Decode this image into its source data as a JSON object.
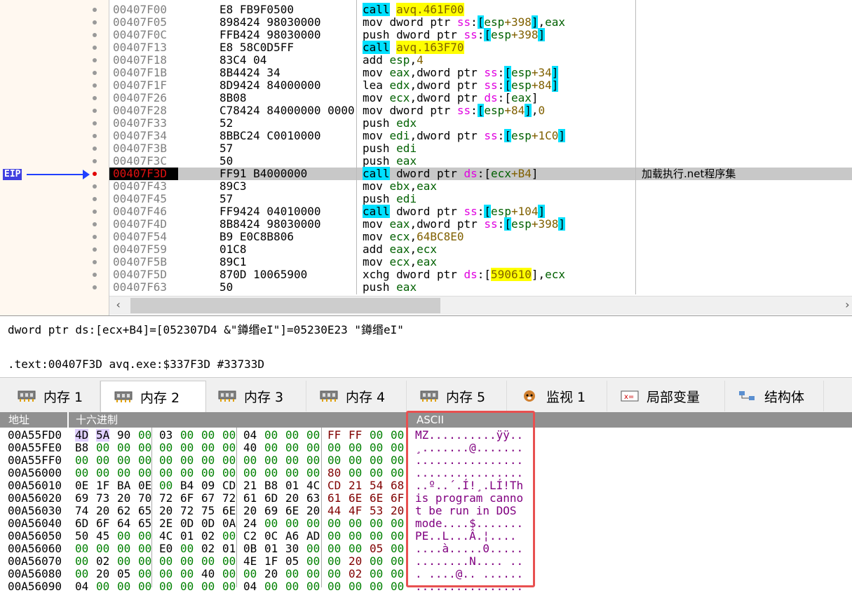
{
  "disasm": {
    "eip_label": "EIP",
    "rows": [
      {
        "addr": "00407F00",
        "bytes": "E8 FB9F0500",
        "instr": [
          {
            "t": "call",
            "c": "kw-call"
          },
          {
            "t": " "
          },
          {
            "t": "avq.461F00",
            "c": "sym"
          }
        ]
      },
      {
        "addr": "00407F05",
        "bytes": "898424 98030000",
        "instr": [
          {
            "t": "mov dword ptr "
          },
          {
            "t": "ss",
            "c": "seg"
          },
          {
            "t": ":"
          },
          {
            "t": "[",
            "c": "brk"
          },
          {
            "t": "esp",
            "c": "reg"
          },
          {
            "t": "+398",
            "c": "num"
          },
          {
            "t": "]",
            "c": "brk"
          },
          {
            "t": ","
          },
          {
            "t": "eax",
            "c": "reg"
          }
        ]
      },
      {
        "addr": "00407F0C",
        "bytes": "FFB424 98030000",
        "instr": [
          {
            "t": "push dword ptr "
          },
          {
            "t": "ss",
            "c": "seg"
          },
          {
            "t": ":"
          },
          {
            "t": "[",
            "c": "brk"
          },
          {
            "t": "esp",
            "c": "reg"
          },
          {
            "t": "+398",
            "c": "num"
          },
          {
            "t": "]",
            "c": "brk"
          }
        ]
      },
      {
        "addr": "00407F13",
        "bytes": "E8 58C0D5FF",
        "instr": [
          {
            "t": "call",
            "c": "kw-call"
          },
          {
            "t": " "
          },
          {
            "t": "avq.163F70",
            "c": "sym"
          }
        ]
      },
      {
        "addr": "00407F18",
        "bytes": "83C4 04",
        "instr": [
          {
            "t": "add "
          },
          {
            "t": "esp",
            "c": "reg"
          },
          {
            "t": ","
          },
          {
            "t": "4",
            "c": "num"
          }
        ]
      },
      {
        "addr": "00407F1B",
        "bytes": "8B4424 34",
        "instr": [
          {
            "t": "mov "
          },
          {
            "t": "eax",
            "c": "reg"
          },
          {
            "t": ",dword ptr "
          },
          {
            "t": "ss",
            "c": "seg"
          },
          {
            "t": ":"
          },
          {
            "t": "[",
            "c": "brk"
          },
          {
            "t": "esp",
            "c": "reg"
          },
          {
            "t": "+34",
            "c": "num"
          },
          {
            "t": "]",
            "c": "brk"
          }
        ]
      },
      {
        "addr": "00407F1F",
        "bytes": "8D9424 84000000",
        "instr": [
          {
            "t": "lea "
          },
          {
            "t": "edx",
            "c": "reg"
          },
          {
            "t": ",dword ptr "
          },
          {
            "t": "ss",
            "c": "seg"
          },
          {
            "t": ":"
          },
          {
            "t": "[",
            "c": "brk"
          },
          {
            "t": "esp",
            "c": "reg"
          },
          {
            "t": "+84",
            "c": "num"
          },
          {
            "t": "]",
            "c": "brk"
          }
        ]
      },
      {
        "addr": "00407F26",
        "bytes": "8B08",
        "instr": [
          {
            "t": "mov "
          },
          {
            "t": "ecx",
            "c": "reg"
          },
          {
            "t": ",dword ptr "
          },
          {
            "t": "ds",
            "c": "seg"
          },
          {
            "t": ":"
          },
          {
            "t": "["
          },
          {
            "t": "eax",
            "c": "reg"
          },
          {
            "t": "]"
          }
        ]
      },
      {
        "addr": "00407F28",
        "bytes": "C78424 84000000 0000",
        "instr": [
          {
            "t": "mov dword ptr "
          },
          {
            "t": "ss",
            "c": "seg"
          },
          {
            "t": ":"
          },
          {
            "t": "[",
            "c": "brk"
          },
          {
            "t": "esp",
            "c": "reg"
          },
          {
            "t": "+84",
            "c": "num"
          },
          {
            "t": "]",
            "c": "brk"
          },
          {
            "t": ","
          },
          {
            "t": "0",
            "c": "num"
          }
        ]
      },
      {
        "addr": "00407F33",
        "bytes": "52",
        "instr": [
          {
            "t": "push "
          },
          {
            "t": "edx",
            "c": "reg"
          }
        ]
      },
      {
        "addr": "00407F34",
        "bytes": "8BBC24 C0010000",
        "instr": [
          {
            "t": "mov "
          },
          {
            "t": "edi",
            "c": "reg"
          },
          {
            "t": ",dword ptr "
          },
          {
            "t": "ss",
            "c": "seg"
          },
          {
            "t": ":"
          },
          {
            "t": "[",
            "c": "brk"
          },
          {
            "t": "esp",
            "c": "reg"
          },
          {
            "t": "+1C0",
            "c": "num"
          },
          {
            "t": "]",
            "c": "brk"
          }
        ]
      },
      {
        "addr": "00407F3B",
        "bytes": "57",
        "instr": [
          {
            "t": "push "
          },
          {
            "t": "edi",
            "c": "reg"
          }
        ]
      },
      {
        "addr": "00407F3C",
        "bytes": "50",
        "instr": [
          {
            "t": "push "
          },
          {
            "t": "eax",
            "c": "reg"
          }
        ]
      },
      {
        "addr": "00407F3D",
        "bytes": "FF91 B4000000",
        "current": true,
        "comment": "加载执行.net程序集",
        "instr": [
          {
            "t": "call",
            "c": "kw-call"
          },
          {
            "t": " dword ptr "
          },
          {
            "t": "ds",
            "c": "seg"
          },
          {
            "t": ":"
          },
          {
            "t": "["
          },
          {
            "t": "ecx",
            "c": "reg"
          },
          {
            "t": "+B4",
            "c": "num"
          },
          {
            "t": "]"
          }
        ]
      },
      {
        "addr": "00407F43",
        "bytes": "89C3",
        "instr": [
          {
            "t": "mov "
          },
          {
            "t": "ebx",
            "c": "reg"
          },
          {
            "t": ","
          },
          {
            "t": "eax",
            "c": "reg"
          }
        ]
      },
      {
        "addr": "00407F45",
        "bytes": "57",
        "instr": [
          {
            "t": "push "
          },
          {
            "t": "edi",
            "c": "reg"
          }
        ]
      },
      {
        "addr": "00407F46",
        "bytes": "FF9424 04010000",
        "instr": [
          {
            "t": "call",
            "c": "kw-call"
          },
          {
            "t": " dword ptr "
          },
          {
            "t": "ss",
            "c": "seg"
          },
          {
            "t": ":"
          },
          {
            "t": "[",
            "c": "brk"
          },
          {
            "t": "esp",
            "c": "reg"
          },
          {
            "t": "+104",
            "c": "num"
          },
          {
            "t": "]",
            "c": "brk"
          }
        ]
      },
      {
        "addr": "00407F4D",
        "bytes": "8B8424 98030000",
        "instr": [
          {
            "t": "mov "
          },
          {
            "t": "eax",
            "c": "reg"
          },
          {
            "t": ",dword ptr "
          },
          {
            "t": "ss",
            "c": "seg"
          },
          {
            "t": ":"
          },
          {
            "t": "[",
            "c": "brk"
          },
          {
            "t": "esp",
            "c": "reg"
          },
          {
            "t": "+398",
            "c": "num"
          },
          {
            "t": "]",
            "c": "brk"
          }
        ]
      },
      {
        "addr": "00407F54",
        "bytes": "B9 E0C8B806",
        "instr": [
          {
            "t": "mov "
          },
          {
            "t": "ecx",
            "c": "reg"
          },
          {
            "t": ","
          },
          {
            "t": "64BC8E0",
            "c": "num"
          }
        ]
      },
      {
        "addr": "00407F59",
        "bytes": "01C8",
        "instr": [
          {
            "t": "add "
          },
          {
            "t": "eax",
            "c": "reg"
          },
          {
            "t": ","
          },
          {
            "t": "ecx",
            "c": "reg"
          }
        ]
      },
      {
        "addr": "00407F5B",
        "bytes": "89C1",
        "instr": [
          {
            "t": "mov "
          },
          {
            "t": "ecx",
            "c": "reg"
          },
          {
            "t": ","
          },
          {
            "t": "eax",
            "c": "reg"
          }
        ]
      },
      {
        "addr": "00407F5D",
        "bytes": "870D 10065900",
        "bytes_ul": "10065900",
        "instr": [
          {
            "t": "xchg dword ptr "
          },
          {
            "t": "ds",
            "c": "seg"
          },
          {
            "t": ":"
          },
          {
            "t": "["
          },
          {
            "t": "590610",
            "c": "sym"
          },
          {
            "t": "]"
          },
          {
            "t": ","
          },
          {
            "t": "ecx",
            "c": "reg"
          }
        ]
      },
      {
        "addr": "00407F63",
        "bytes": "50",
        "instr": [
          {
            "t": "push "
          },
          {
            "t": "eax",
            "c": "reg"
          }
        ]
      }
    ]
  },
  "info": {
    "line1": "dword ptr ds:[ecx+B4]=[052307D4 &\"鐏缗eI\"]=05230E23 \"鐏缗eI\"",
    "line2": ".text:00407F3D avq.exe:$337F3D #33733D"
  },
  "tabs": [
    {
      "label": "内存 1",
      "icon": "memory-chip-icon"
    },
    {
      "label": "内存 2",
      "icon": "memory-chip-icon",
      "active": true
    },
    {
      "label": "内存 3",
      "icon": "memory-chip-icon"
    },
    {
      "label": "内存 4",
      "icon": "memory-chip-icon"
    },
    {
      "label": "内存 5",
      "icon": "memory-chip-icon"
    },
    {
      "label": "监视 1",
      "icon": "dog-face-icon"
    },
    {
      "label": "局部变量",
      "icon": "variable-icon"
    },
    {
      "label": "结构体",
      "icon": "structure-icon"
    }
  ],
  "dump": {
    "headers": {
      "addr": "地址",
      "hex": "十六进制",
      "ascii": "ASCII"
    },
    "rows": [
      {
        "addr": "00A55FD0",
        "hex": [
          "4D",
          "5A",
          "90",
          "00",
          "03",
          "00",
          "00",
          "00",
          "04",
          "00",
          "00",
          "00",
          "FF",
          "FF",
          "00",
          "00"
        ],
        "ascii": "MZ..........ÿÿ.."
      },
      {
        "addr": "00A55FE0",
        "hex": [
          "B8",
          "00",
          "00",
          "00",
          "00",
          "00",
          "00",
          "00",
          "40",
          "00",
          "00",
          "00",
          "00",
          "00",
          "00",
          "00"
        ],
        "ascii": "¸.......@......."
      },
      {
        "addr": "00A55FF0",
        "hex": [
          "00",
          "00",
          "00",
          "00",
          "00",
          "00",
          "00",
          "00",
          "00",
          "00",
          "00",
          "00",
          "00",
          "00",
          "00",
          "00"
        ],
        "ascii": "................"
      },
      {
        "addr": "00A56000",
        "hex": [
          "00",
          "00",
          "00",
          "00",
          "00",
          "00",
          "00",
          "00",
          "00",
          "00",
          "00",
          "00",
          "80",
          "00",
          "00",
          "00"
        ],
        "ascii": "................"
      },
      {
        "addr": "00A56010",
        "hex": [
          "0E",
          "1F",
          "BA",
          "0E",
          "00",
          "B4",
          "09",
          "CD",
          "21",
          "B8",
          "01",
          "4C",
          "CD",
          "21",
          "54",
          "68"
        ],
        "ascii": "..º..´.Í!¸.LÍ!Th"
      },
      {
        "addr": "00A56020",
        "hex": [
          "69",
          "73",
          "20",
          "70",
          "72",
          "6F",
          "67",
          "72",
          "61",
          "6D",
          "20",
          "63",
          "61",
          "6E",
          "6E",
          "6F"
        ],
        "ascii": "is program canno"
      },
      {
        "addr": "00A56030",
        "hex": [
          "74",
          "20",
          "62",
          "65",
          "20",
          "72",
          "75",
          "6E",
          "20",
          "69",
          "6E",
          "20",
          "44",
          "4F",
          "53",
          "20"
        ],
        "ascii": "t be run in DOS "
      },
      {
        "addr": "00A56040",
        "hex": [
          "6D",
          "6F",
          "64",
          "65",
          "2E",
          "0D",
          "0D",
          "0A",
          "24",
          "00",
          "00",
          "00",
          "00",
          "00",
          "00",
          "00"
        ],
        "ascii": "mode....$......."
      },
      {
        "addr": "00A56050",
        "hex": [
          "50",
          "45",
          "00",
          "00",
          "4C",
          "01",
          "02",
          "00",
          "C2",
          "0C",
          "A6",
          "AD",
          "00",
          "00",
          "00",
          "00"
        ],
        "ascii": "PE..L...Â.¦­...."
      },
      {
        "addr": "00A56060",
        "hex": [
          "00",
          "00",
          "00",
          "00",
          "E0",
          "00",
          "02",
          "01",
          "0B",
          "01",
          "30",
          "00",
          "00",
          "00",
          "05",
          "00"
        ],
        "ascii": "....à.....0....."
      },
      {
        "addr": "00A56070",
        "hex": [
          "00",
          "02",
          "00",
          "00",
          "00",
          "00",
          "00",
          "00",
          "4E",
          "1F",
          "05",
          "00",
          "00",
          "20",
          "00",
          "00"
        ],
        "ascii": "........N.... .."
      },
      {
        "addr": "00A56080",
        "hex": [
          "00",
          "20",
          "05",
          "00",
          "00",
          "00",
          "40",
          "00",
          "00",
          "20",
          "00",
          "00",
          "00",
          "02",
          "00",
          "00"
        ],
        "ascii": ". ....@.. ......"
      },
      {
        "addr": "00A56090",
        "hex": [
          "04",
          "00",
          "00",
          "00",
          "00",
          "00",
          "00",
          "00",
          "04",
          "00",
          "00",
          "00",
          "00",
          "00",
          "00",
          "00"
        ],
        "ascii": "................"
      }
    ]
  },
  "colors": {
    "ascii_highlight": "#e85050",
    "eip_arrow": "#2040ff",
    "current_line": "#c8c8c8"
  }
}
